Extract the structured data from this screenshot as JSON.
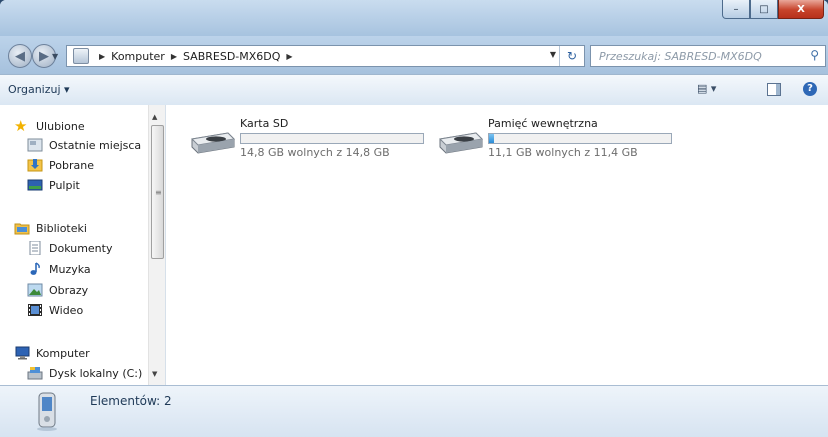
{
  "window": {
    "controls": {
      "minimize": "–",
      "maximize": "□",
      "close": "X"
    }
  },
  "nav": {
    "back_icon": "back-arrow-icon",
    "forward_icon": "forward-arrow-icon",
    "breadcrumbs": [
      "Komputer",
      "SABRESD-MX6DQ"
    ],
    "search_placeholder": "Przeszukaj: SABRESD-MX6DQ"
  },
  "toolbar": {
    "organize_label": "Organizuj ▾",
    "views_label": "▾"
  },
  "sidebar": {
    "favorites_label": "Ulubione",
    "favorites": [
      "Ostatnie miejsca",
      "Pobrane",
      "Pulpit"
    ],
    "libraries_label": "Biblioteki",
    "libraries": [
      "Dokumenty",
      "Muzyka",
      "Obrazy",
      "Wideo"
    ],
    "computer_label": "Komputer",
    "drives": [
      "Dysk lokalny (C:)"
    ]
  },
  "devices": [
    {
      "name": "Karta SD",
      "size": "14,8 GB wolnych z 14,8 GB",
      "used_fraction": 0.0
    },
    {
      "name": "Pamięć wewnętrzna",
      "size": "11,1 GB wolnych z 11,4 GB",
      "used_fraction": 0.026
    }
  ],
  "details": {
    "count": "Elementów: 2"
  },
  "colors": {
    "accent": "#2a8bd6",
    "title_bar": "#a7c3df",
    "close": "#c7432b"
  }
}
